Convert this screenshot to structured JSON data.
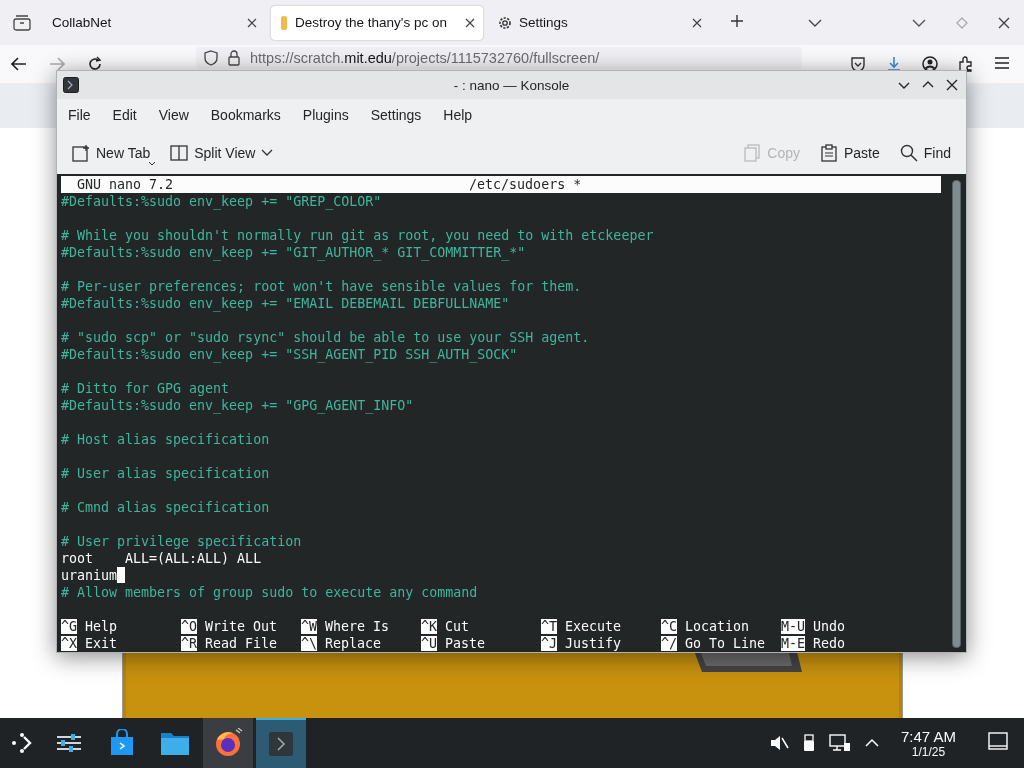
{
  "browser": {
    "tabs": [
      {
        "label": "CollabNet",
        "kind": "plain",
        "selected": false
      },
      {
        "label": "Destroy the thany's pc on",
        "kind": "page",
        "selected": true
      },
      {
        "label": "Settings",
        "kind": "settings",
        "selected": false
      }
    ],
    "url": {
      "start": "https://scratch.",
      "domain": "mit.edu",
      "path": "/projects/1115732760/fullscreen/"
    }
  },
  "konsole": {
    "title": "- : nano — Konsole",
    "menu": [
      "File",
      "Edit",
      "View",
      "Bookmarks",
      "Plugins",
      "Settings",
      "Help"
    ],
    "toolbar": [
      {
        "label": "New Tab",
        "kind": "new-tab",
        "disabled": false
      },
      {
        "label": "Split View",
        "kind": "split",
        "disabled": false
      },
      {
        "label": "Copy",
        "kind": "copy",
        "disabled": true
      },
      {
        "label": "Paste",
        "kind": "paste",
        "disabled": false
      },
      {
        "label": "Find",
        "kind": "find",
        "disabled": false
      }
    ],
    "nano": {
      "version": "GNU nano 7.2",
      "file": "/etc/sudoers *",
      "lines": [
        {
          "kind": "comment",
          "text": "#Defaults:%sudo env_keep += \"GREP_COLOR\""
        },
        {
          "kind": "blank"
        },
        {
          "kind": "comment",
          "text": "# While you shouldn't normally run git as root, you need to with etckeeper"
        },
        {
          "kind": "comment",
          "text": "#Defaults:%sudo env_keep += \"GIT_AUTHOR_* GIT_COMMITTER_*\""
        },
        {
          "kind": "blank"
        },
        {
          "kind": "comment",
          "text": "# Per-user preferences; root won't have sensible values for them."
        },
        {
          "kind": "comment",
          "text": "#Defaults:%sudo env_keep += \"EMAIL DEBEMAIL DEBFULLNAME\""
        },
        {
          "kind": "blank"
        },
        {
          "kind": "comment",
          "text": "# \"sudo scp\" or \"sudo rsync\" should be able to use your SSH agent."
        },
        {
          "kind": "comment",
          "text": "#Defaults:%sudo env_keep += \"SSH_AGENT_PID SSH_AUTH_SOCK\""
        },
        {
          "kind": "blank"
        },
        {
          "kind": "comment",
          "text": "# Ditto for GPG agent"
        },
        {
          "kind": "comment",
          "text": "#Defaults:%sudo env_keep += \"GPG_AGENT_INFO\""
        },
        {
          "kind": "blank"
        },
        {
          "kind": "comment",
          "text": "# Host alias specification"
        },
        {
          "kind": "blank"
        },
        {
          "kind": "comment",
          "text": "# User alias specification"
        },
        {
          "kind": "blank"
        },
        {
          "kind": "comment",
          "text": "# Cmnd alias specification"
        },
        {
          "kind": "blank"
        },
        {
          "kind": "comment",
          "text": "# User privilege specification"
        },
        {
          "kind": "code",
          "text": "root    ALL=(ALL:ALL) ALL",
          "cursor": false
        },
        {
          "kind": "code",
          "text": "uranium",
          "cursor": true
        },
        {
          "kind": "comment",
          "text": "# Allow members of group sudo to execute any command"
        },
        {
          "kind": "blank"
        }
      ],
      "shortcuts": [
        [
          {
            "key": "^G",
            "label": "Help"
          },
          {
            "key": "^X",
            "label": "Exit"
          }
        ],
        [
          {
            "key": "^O",
            "label": "Write Out"
          },
          {
            "key": "^R",
            "label": "Read File"
          }
        ],
        [
          {
            "key": "^W",
            "label": "Where Is"
          },
          {
            "key": "^\\",
            "label": "Replace"
          }
        ],
        [
          {
            "key": "^K",
            "label": "Cut"
          },
          {
            "key": "^U",
            "label": "Paste"
          }
        ],
        [
          {
            "key": "^T",
            "label": "Execute"
          },
          {
            "key": "^J",
            "label": "Justify"
          }
        ],
        [
          {
            "key": "^C",
            "label": "Location"
          },
          {
            "key": "^/",
            "label": "Go To Line"
          }
        ],
        [
          {
            "key": "M-U",
            "label": "Undo"
          },
          {
            "key": "M-E",
            "label": "Redo"
          }
        ]
      ]
    }
  },
  "taskbar": {
    "tasks": [
      {
        "kind": "settings",
        "running": false,
        "selected": false
      },
      {
        "kind": "store",
        "running": false,
        "selected": false
      },
      {
        "kind": "files",
        "running": false,
        "selected": false
      },
      {
        "kind": "browser",
        "running": true,
        "selected": false
      },
      {
        "kind": "terminal",
        "running": true,
        "selected": true
      }
    ],
    "time": "7:47 AM",
    "date": "1/1/25"
  }
}
